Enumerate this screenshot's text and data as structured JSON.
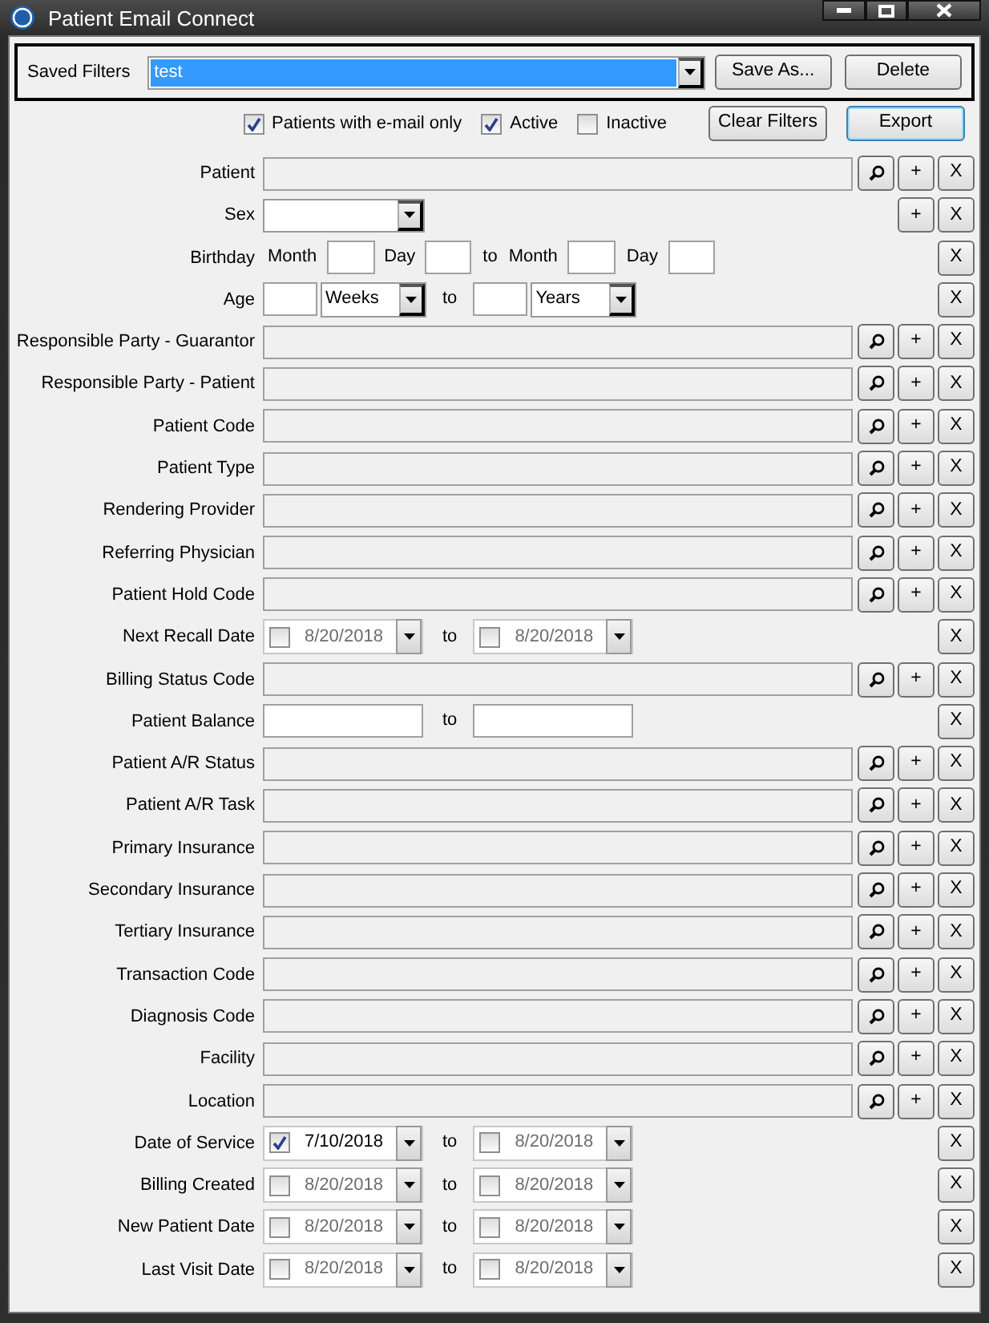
{
  "window": {
    "title": "Patient Email Connect"
  },
  "saved_filters": {
    "label": "Saved Filters",
    "value": "test",
    "buttons": [
      "Save As...",
      "Delete"
    ]
  },
  "options": [
    {
      "label": "Patients with e-mail only",
      "checked": true
    },
    {
      "label": "Active",
      "checked": true
    },
    {
      "label": "Inactive",
      "checked": false
    }
  ],
  "actions": [
    {
      "label": "Clear Filters",
      "default": false
    },
    {
      "label": "Export",
      "default": true
    }
  ],
  "filters": [
    {
      "kind": "lookup",
      "label": "Patient",
      "add": "+",
      "clear": "X"
    },
    {
      "kind": "select",
      "label": "Sex",
      "add": "+",
      "clear": "X"
    },
    {
      "kind": "birthday",
      "label": "Birthday",
      "words": [
        "Month",
        "Day",
        "to",
        "Month",
        "Day"
      ],
      "clear": "X"
    },
    {
      "kind": "age",
      "label": "Age",
      "from_unit": "Weeks",
      "to": "to",
      "to_unit": "Years",
      "clear": "X"
    },
    {
      "kind": "lookup",
      "label": "Responsible Party - Guarantor",
      "add": "+",
      "clear": "X"
    },
    {
      "kind": "lookup",
      "label": "Responsible Party - Patient",
      "add": "+",
      "clear": "X"
    },
    {
      "kind": "lookup",
      "label": "Patient Code",
      "add": "+",
      "clear": "X"
    },
    {
      "kind": "lookup",
      "label": "Patient Type",
      "add": "+",
      "clear": "X"
    },
    {
      "kind": "lookup",
      "label": "Rendering Provider",
      "add": "+",
      "clear": "X"
    },
    {
      "kind": "lookup",
      "label": "Referring Physician",
      "add": "+",
      "clear": "X"
    },
    {
      "kind": "lookup",
      "label": "Patient Hold Code",
      "add": "+",
      "clear": "X"
    },
    {
      "kind": "daterange",
      "label": "Next Recall Date",
      "from": {
        "date": "8/20/2018",
        "checked": false
      },
      "to": "to",
      "until": {
        "date": "8/20/2018",
        "checked": false
      },
      "clear": "X"
    },
    {
      "kind": "lookup",
      "label": "Billing Status Code",
      "add": "+",
      "clear": "X"
    },
    {
      "kind": "range",
      "label": "Patient Balance",
      "to": "to",
      "clear": "X"
    },
    {
      "kind": "lookup",
      "label": "Patient A/R Status",
      "add": "+",
      "clear": "X"
    },
    {
      "kind": "lookup",
      "label": "Patient A/R Task",
      "add": "+",
      "clear": "X"
    },
    {
      "kind": "lookup",
      "label": "Primary Insurance",
      "add": "+",
      "clear": "X"
    },
    {
      "kind": "lookup",
      "label": "Secondary Insurance",
      "add": "+",
      "clear": "X"
    },
    {
      "kind": "lookup",
      "label": "Tertiary Insurance",
      "add": "+",
      "clear": "X"
    },
    {
      "kind": "lookup",
      "label": "Transaction Code",
      "add": "+",
      "clear": "X"
    },
    {
      "kind": "lookup",
      "label": "Diagnosis Code",
      "add": "+",
      "clear": "X"
    },
    {
      "kind": "lookup",
      "label": "Facility",
      "add": "+",
      "clear": "X"
    },
    {
      "kind": "lookup",
      "label": "Location",
      "add": "+",
      "clear": "X"
    },
    {
      "kind": "daterange",
      "label": "Date of Service",
      "from": {
        "date": "7/10/2018",
        "checked": true
      },
      "to": "to",
      "until": {
        "date": "8/20/2018",
        "checked": false
      },
      "clear": "X"
    },
    {
      "kind": "daterange",
      "label": "Billing Created",
      "from": {
        "date": "8/20/2018",
        "checked": false
      },
      "to": "to",
      "until": {
        "date": "8/20/2018",
        "checked": false
      },
      "clear": "X"
    },
    {
      "kind": "daterange",
      "label": "New Patient Date",
      "from": {
        "date": "8/20/2018",
        "checked": false
      },
      "to": "to",
      "until": {
        "date": "8/20/2018",
        "checked": false
      },
      "clear": "X"
    },
    {
      "kind": "daterange",
      "label": "Last Visit Date",
      "from": {
        "date": "8/20/2018",
        "checked": false
      },
      "to": "to",
      "until": {
        "date": "8/20/2018",
        "checked": false
      },
      "clear": "X"
    }
  ]
}
